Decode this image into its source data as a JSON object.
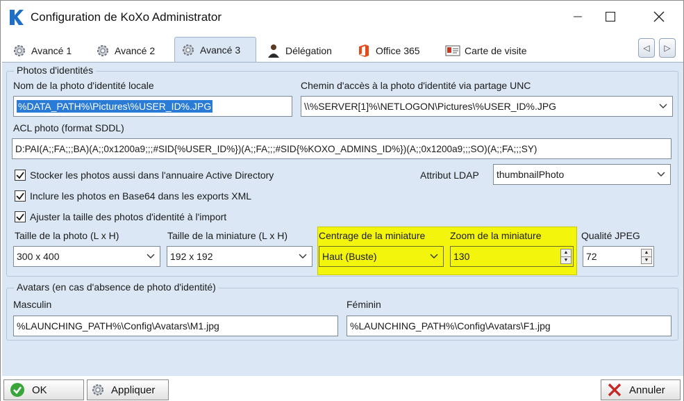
{
  "window": {
    "title": "Configuration de KoXo Administrator",
    "controls": {
      "minimize": "—",
      "maximize": "☐",
      "close": "✕"
    }
  },
  "tabs": [
    {
      "label": "Avancé 1",
      "icon": "gear-icon",
      "active": false
    },
    {
      "label": "Avancé 2",
      "icon": "gear-icon",
      "active": false
    },
    {
      "label": "Avancé 3",
      "icon": "gear-icon",
      "active": true
    },
    {
      "label": "Délégation",
      "icon": "person-icon",
      "active": false
    },
    {
      "label": "Office 365",
      "icon": "office-icon",
      "active": false
    },
    {
      "label": "Carte de visite",
      "icon": "business-card-icon",
      "active": false
    }
  ],
  "tab_nav": {
    "prev": "◁",
    "next": "▷"
  },
  "photos": {
    "group_title": "Photos d'identités",
    "local_name_label": "Nom de la photo d'identité locale",
    "local_name_value": "%DATA_PATH%\\Pictures\\%USER_ID%.JPG",
    "unc_label": "Chemin d'accès à la photo d'identité via partage UNC",
    "unc_value": "\\\\%SERVER[1]%\\NETLOGON\\Pictures\\%USER_ID%.JPG",
    "acl_label": "ACL photo (format SDDL)",
    "acl_value": "D:PAI(A;;FA;;;BA)(A;;0x1200a9;;;#SID{%USER_ID%})(A;;FA;;;#SID{%KOXO_ADMINS_ID%})(A;;0x1200a9;;;SO)(A;;FA;;;SY)",
    "chk_store_ad": "Stocker les photos aussi dans l'annuaire Active Directory",
    "chk_base64": "Inclure les photos en Base64 dans les exports XML",
    "chk_resize": "Ajuster la taille des photos d'identité à l'import",
    "ldap_label": "Attribut LDAP",
    "ldap_value": "thumbnailPhoto",
    "photo_size_label": "Taille de la photo (L x H)",
    "photo_size_value": "300 x 400",
    "thumb_size_label": "Taille de la miniature (L x H)",
    "thumb_size_value": "192 x 192",
    "thumb_center_label": "Centrage de la miniature",
    "thumb_center_value": "Haut (Buste)",
    "thumb_zoom_label": "Zoom de la miniature",
    "thumb_zoom_value": "130",
    "jpeg_quality_label": "Qualité JPEG",
    "jpeg_quality_value": "72"
  },
  "avatars": {
    "group_title": "Avatars (en cas d'absence de photo d'identité)",
    "male_label": "Masculin",
    "male_value": "%LAUNCHING_PATH%\\Config\\Avatars\\M1.jpg",
    "female_label": "Féminin",
    "female_value": "%LAUNCHING_PATH%\\Config\\Avatars\\F1.jpg"
  },
  "buttons": {
    "ok": "OK",
    "apply": "Appliquer",
    "cancel": "Annuler"
  },
  "colors": {
    "panel_bg": "#dbe7f4",
    "highlight": "#f4f50c",
    "selection": "#2a7bd6",
    "logo_blue": "#1f6fc4"
  }
}
